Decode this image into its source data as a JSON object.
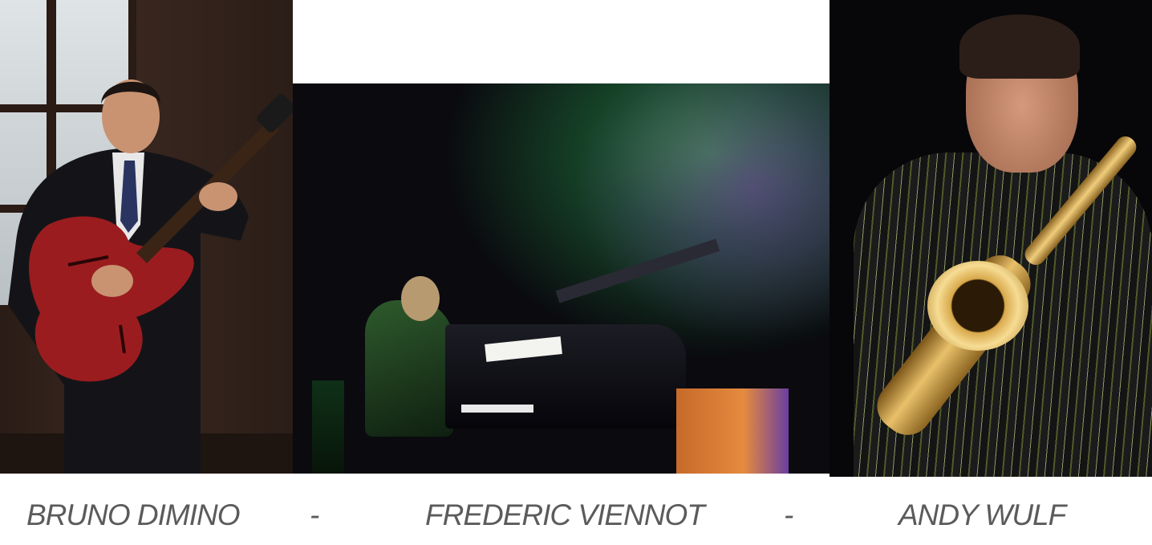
{
  "photos": [
    {
      "subject": "guitarist-photo"
    },
    {
      "subject": "pianist-photo"
    },
    {
      "subject": "saxophonist-photo"
    }
  ],
  "captions": {
    "name_1": "BRUNO DIMINO",
    "separator_1": "-",
    "name_2": "FREDERIC VIENNOT",
    "separator_2": "-",
    "name_3": "ANDY WULF"
  }
}
